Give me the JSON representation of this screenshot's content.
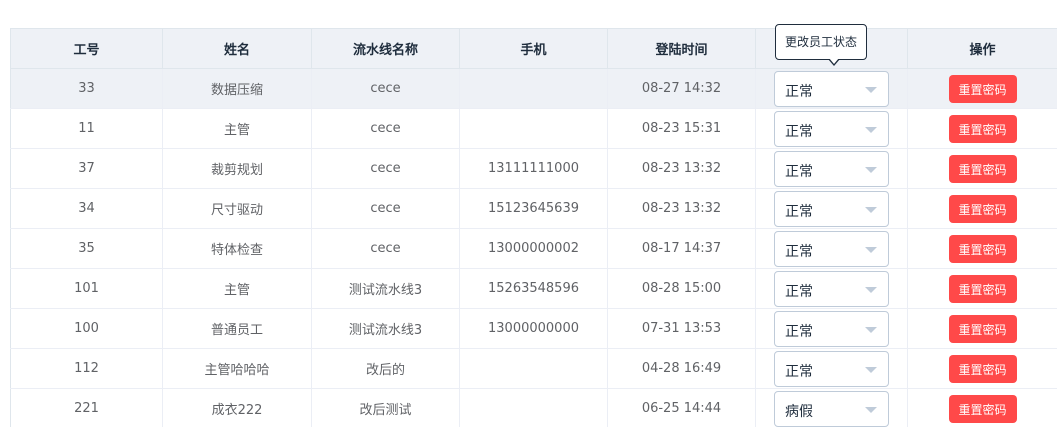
{
  "table": {
    "headers": [
      "工号",
      "姓名",
      "流水线名称",
      "手机",
      "登陆时间",
      "",
      "操作"
    ],
    "rows": [
      {
        "id": "33",
        "name": "数据压缩",
        "line": "cece",
        "phone": "",
        "login": "08-27 14:32",
        "status": "正常",
        "action": "重置密码"
      },
      {
        "id": "11",
        "name": "主管",
        "line": "cece",
        "phone": "",
        "login": "08-23 15:31",
        "status": "正常",
        "action": "重置密码"
      },
      {
        "id": "37",
        "name": "裁剪规划",
        "line": "cece",
        "phone": "13111111000",
        "login": "08-23 13:32",
        "status": "正常",
        "action": "重置密码"
      },
      {
        "id": "34",
        "name": "尺寸驱动",
        "line": "cece",
        "phone": "15123645639",
        "login": "08-23 13:32",
        "status": "正常",
        "action": "重置密码"
      },
      {
        "id": "35",
        "name": "特体检查",
        "line": "cece",
        "phone": "13000000002",
        "login": "08-17 14:37",
        "status": "正常",
        "action": "重置密码"
      },
      {
        "id": "101",
        "name": "主管",
        "line": "测试流水线3",
        "phone": "15263548596",
        "login": "08-28 15:00",
        "status": "正常",
        "action": "重置密码"
      },
      {
        "id": "100",
        "name": "普通员工",
        "line": "测试流水线3",
        "phone": "13000000000",
        "login": "07-31 13:53",
        "status": "正常",
        "action": "重置密码"
      },
      {
        "id": "112",
        "name": "主管哈哈哈",
        "line": "改后的",
        "phone": "",
        "login": "04-28 16:49",
        "status": "正常",
        "action": "重置密码"
      },
      {
        "id": "221",
        "name": "成衣222",
        "line": "改后测试",
        "phone": "",
        "login": "06-25 14:44",
        "status": "病假",
        "action": "重置密码"
      }
    ]
  },
  "tooltip": {
    "text": "更改员工状态"
  },
  "colors": {
    "header_bg": "#eef1f6",
    "danger": "#ff4949",
    "border": "#dfe6ec"
  }
}
